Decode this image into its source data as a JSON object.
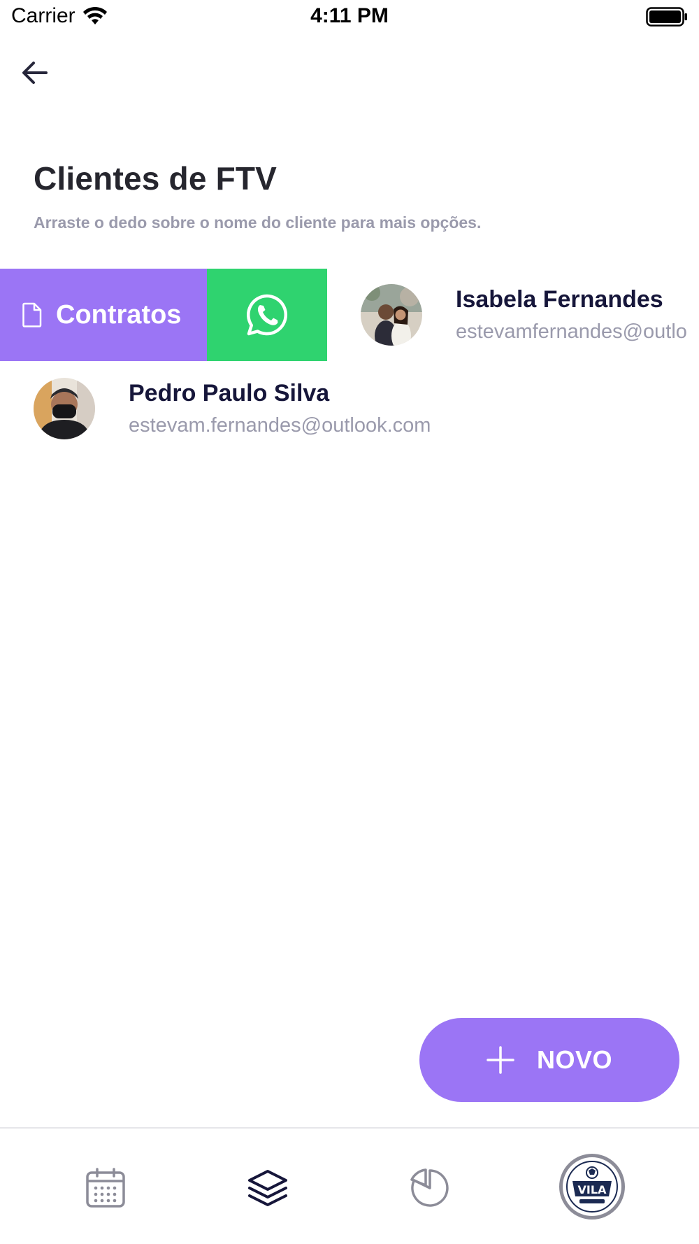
{
  "status_bar": {
    "carrier": "Carrier",
    "time": "4:11 PM",
    "wifi_icon": "wifi-icon",
    "battery_icon": "battery-icon"
  },
  "header": {
    "back_icon": "arrow-left-icon",
    "title": "Clientes de FTV",
    "subtitle": "Arraste o dedo sobre o nome do cliente para mais opções."
  },
  "swipe_actions": {
    "contratos_label": "Contratos",
    "contratos_icon": "document-icon",
    "whatsapp_icon": "whatsapp-icon"
  },
  "clients": [
    {
      "name": "Isabela Fernandes",
      "email": "estevamfernandes@outlo"
    },
    {
      "name": "Pedro Paulo Silva",
      "email": "estevam.fernandes@outlook.com"
    }
  ],
  "novo_button": {
    "label": "NOVO",
    "icon": "plus-icon"
  },
  "bottom_nav": {
    "items": [
      {
        "icon": "calendar-icon"
      },
      {
        "icon": "layers-icon"
      },
      {
        "icon": "pie-chart-icon"
      },
      {
        "icon": "profile-logo",
        "logo_text": "VILA"
      }
    ]
  },
  "colors": {
    "accent_purple": "#9b75f5",
    "whatsapp_green": "#2fd36f",
    "title_dark": "#26262e",
    "muted_gray": "#9a9aac",
    "name_navy": "#16163a"
  }
}
